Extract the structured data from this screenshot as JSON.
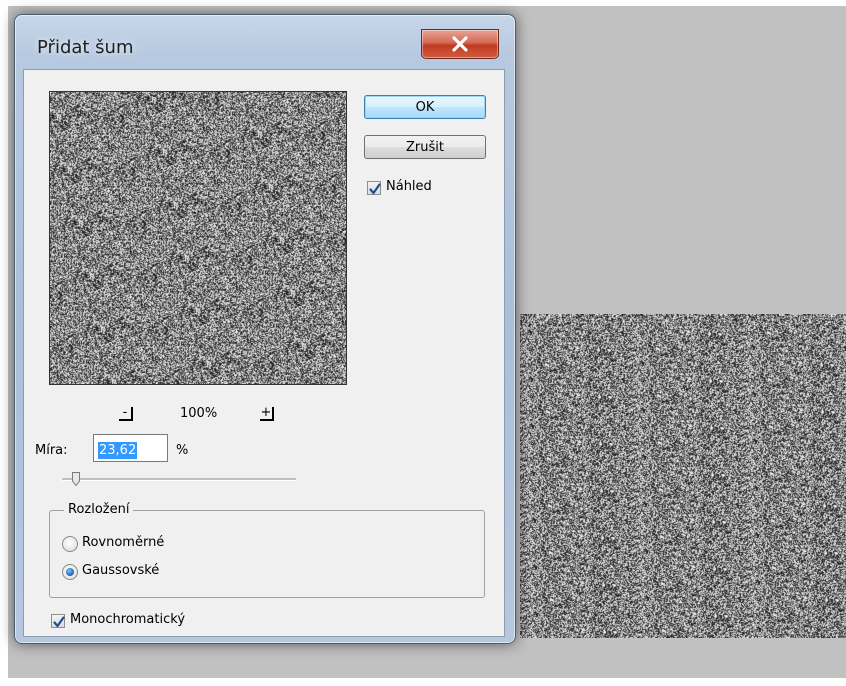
{
  "dialog": {
    "title": "Přidat šum",
    "buttons": {
      "ok": "OK",
      "cancel": "Zrušit"
    },
    "preview_checkbox": {
      "label": "Náhled",
      "checked": true
    },
    "zoom": {
      "level": "100%",
      "decrease_label": "-",
      "increase_label": "+"
    },
    "amount": {
      "label": "Míra:",
      "value": "23,62",
      "unit": "%",
      "slider_fraction": 0.06
    },
    "distribution": {
      "legend": "Rozložení",
      "options": [
        {
          "label": "Rovnoměrné",
          "selected": false
        },
        {
          "label": "Gaussovské",
          "selected": true
        }
      ]
    },
    "monochromatic": {
      "label": "Monochromatický",
      "checked": true
    }
  },
  "icons": {
    "close": "close-icon",
    "check": "checkmark-icon"
  },
  "colors": {
    "close_button": "#c9462f",
    "ok_button": "#bee6fd",
    "selection": "#3399ff",
    "workspace": "#c1c1c1"
  }
}
